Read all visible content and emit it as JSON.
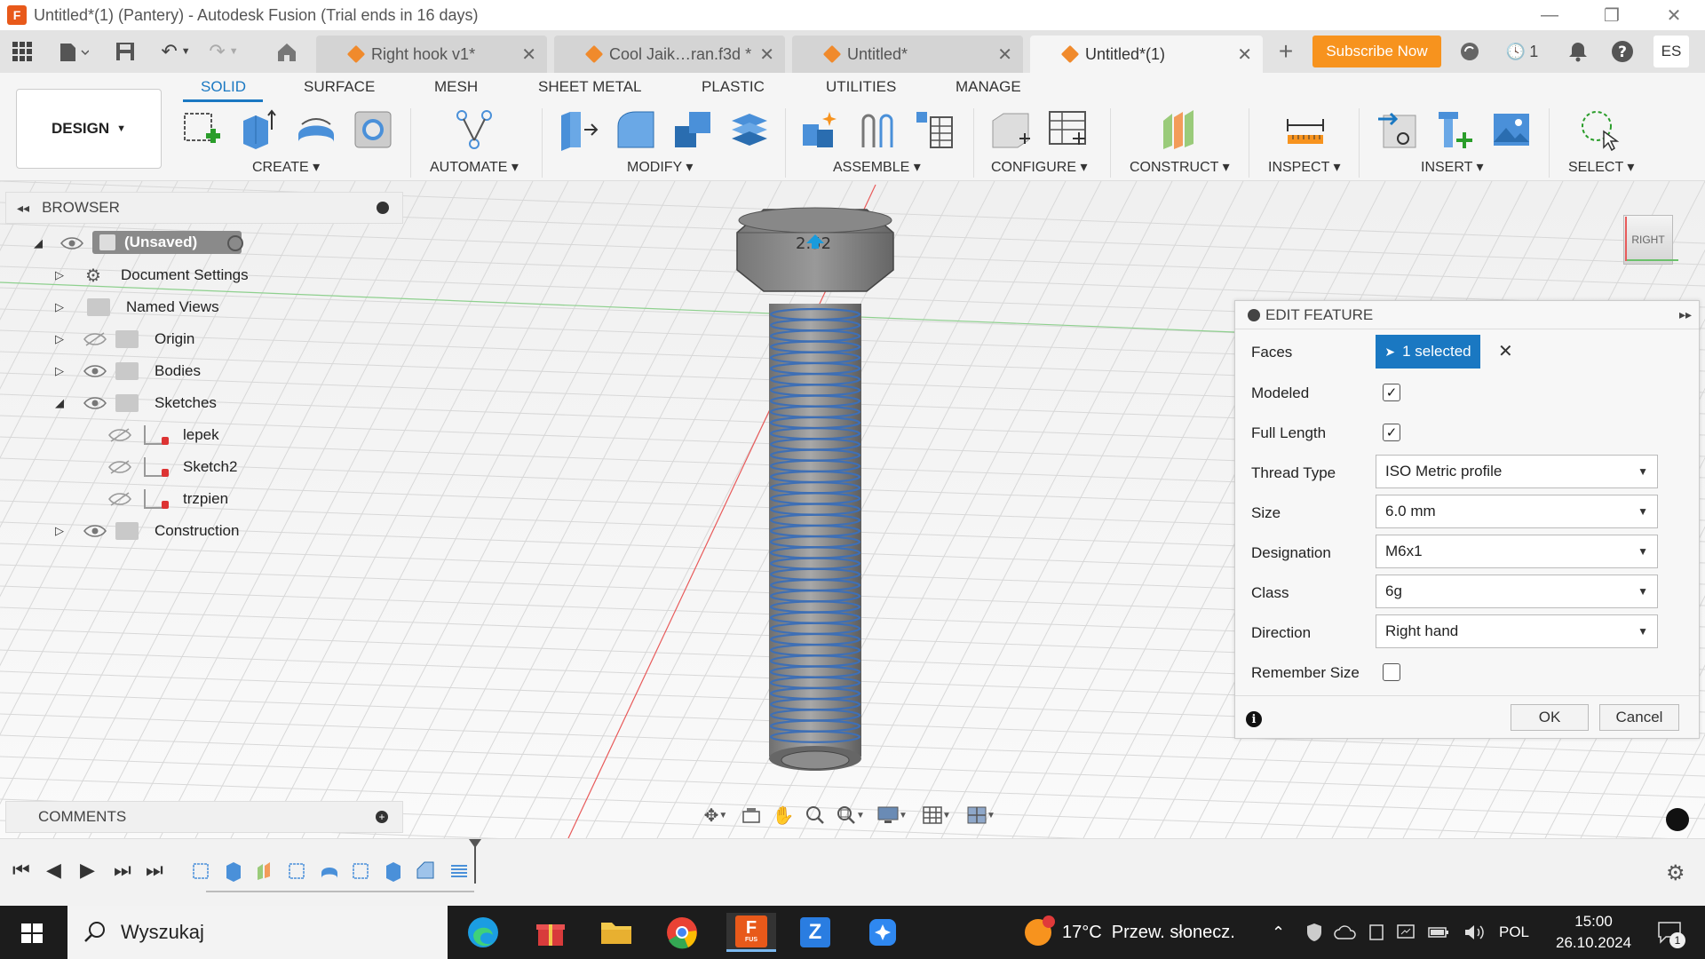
{
  "window": {
    "title": "Untitled*(1) (Pantery) - Autodesk Fusion (Trial ends in 16 days)",
    "logo": "F"
  },
  "tabs": [
    {
      "label": "Right hook v1*"
    },
    {
      "label": "Cool Jaik…ran.f3d *"
    },
    {
      "label": "Untitled*"
    },
    {
      "label": "Untitled*(1)"
    }
  ],
  "header": {
    "subscribe_label": "Subscribe Now",
    "jobs_count": "1",
    "user_initials": "ES"
  },
  "ribbon": {
    "tabs": [
      "SOLID",
      "SURFACE",
      "MESH",
      "SHEET METAL",
      "PLASTIC",
      "UTILITIES",
      "MANAGE"
    ],
    "workspace": "DESIGN",
    "groups": [
      "CREATE",
      "AUTOMATE",
      "MODIFY",
      "ASSEMBLE",
      "CONFIGURE",
      "CONSTRUCT",
      "INSPECT",
      "INSERT",
      "SELECT"
    ]
  },
  "browser": {
    "title": "BROWSER",
    "root": "(Unsaved)",
    "items": [
      "Document Settings",
      "Named Views",
      "Origin",
      "Bodies",
      "Sketches",
      "lepek",
      "Sketch2",
      "trzpien",
      "Construction"
    ]
  },
  "comments": {
    "title": "COMMENTS"
  },
  "viewcube": {
    "label": "RIGHT"
  },
  "edit_feature": {
    "title": "EDIT FEATURE",
    "faces_label": "Faces",
    "faces_value": "1 selected",
    "modeled_label": "Modeled",
    "modeled": true,
    "full_length_label": "Full Length",
    "full_length": true,
    "thread_type_label": "Thread Type",
    "thread_type": "ISO Metric profile",
    "size_label": "Size",
    "size": "6.0 mm",
    "designation_label": "Designation",
    "designation": "M6x1",
    "class_label": "Class",
    "class": "6g",
    "direction_label": "Direction",
    "direction": "Right hand",
    "remember_size_label": "Remember Size",
    "remember_size": false,
    "ok_label": "OK",
    "cancel_label": "Cancel"
  },
  "model": {
    "dimension_label": "2.52"
  },
  "taskbar": {
    "search_placeholder": "Wyszukaj",
    "weather": "17°C  Przew. słonecz.",
    "language": "POL",
    "time": "15:00",
    "date": "26.10.2024",
    "notifications": "1",
    "fusion_badge": "F",
    "fusion_sub": "FUS",
    "z_label": "Z"
  }
}
